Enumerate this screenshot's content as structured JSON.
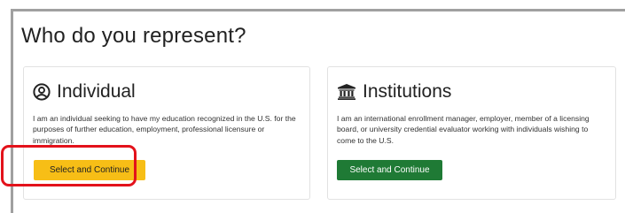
{
  "page": {
    "title": "Who do you represent?"
  },
  "cards": {
    "individual": {
      "icon": "user-circle-icon",
      "title": "Individual",
      "description": "I am an individual seeking to have my education recognized in the U.S. for the purposes of further education, employment, professional licensure or immigration.",
      "button_label": "Select and Continue",
      "button_color": "#f7be16"
    },
    "institutions": {
      "icon": "institution-building-icon",
      "title": "Institutions",
      "description": "I am an international enrollment manager, employer, member of a licensing board, or university credential evaluator working with individuals wishing to come to the U.S.",
      "button_label": "Select and Continue",
      "button_color": "#1f7a35"
    }
  },
  "annotation": {
    "highlight_color": "#e3121b"
  }
}
